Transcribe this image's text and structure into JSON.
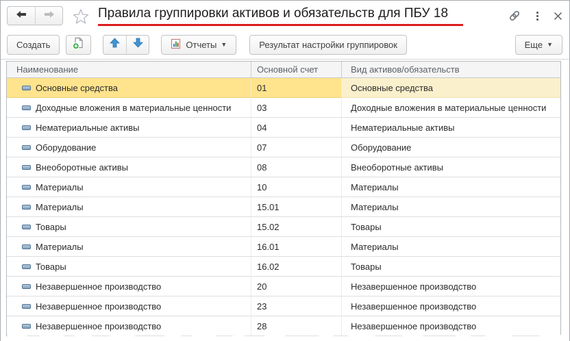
{
  "window": {
    "title": "Правила группировки активов и обязательств для ПБУ 18"
  },
  "caption_icons": {
    "link": "link-icon",
    "menu": "kebab-menu-icon",
    "close": "close-icon",
    "back": "back-arrow-icon",
    "forward": "forward-arrow-icon",
    "favorite": "star-icon"
  },
  "toolbar": {
    "create_label": "Создать",
    "create_group_icon": "create-group-icon",
    "move_up_icon": "arrow-up-icon",
    "move_down_icon": "arrow-down-icon",
    "reports_label": "Отчеты",
    "reports_icon": "report-chart-icon",
    "result_label": "Результат настройки группировок",
    "more_label": "Еще",
    "caret_char": "▼"
  },
  "table": {
    "columns": [
      "Наименование",
      "Основной счет",
      "Вид активов/обязательств"
    ],
    "selected_row_index": 0,
    "rows": [
      {
        "name": "Основные средства",
        "account": "01",
        "kind": "Основные средства"
      },
      {
        "name": "Доходные вложения в материальные ценности",
        "account": "03",
        "kind": "Доходные вложения в материальные ценности"
      },
      {
        "name": "Нематериальные активы",
        "account": "04",
        "kind": "Нематериальные активы"
      },
      {
        "name": "Оборудование",
        "account": "07",
        "kind": "Оборудование"
      },
      {
        "name": "Внеоборотные активы",
        "account": "08",
        "kind": "Внеоборотные активы"
      },
      {
        "name": "Материалы",
        "account": "10",
        "kind": "Материалы"
      },
      {
        "name": "Материалы",
        "account": "15.01",
        "kind": "Материалы"
      },
      {
        "name": "Товары",
        "account": "15.02",
        "kind": "Товары"
      },
      {
        "name": "Материалы",
        "account": "16.01",
        "kind": "Материалы"
      },
      {
        "name": "Товары",
        "account": "16.02",
        "kind": "Товары"
      },
      {
        "name": "Незавершенное производство",
        "account": "20",
        "kind": "Незавершенное производство"
      },
      {
        "name": "Незавершенное производство",
        "account": "23",
        "kind": "Незавершенное производство"
      },
      {
        "name": "Незавершенное производство",
        "account": "28",
        "kind": "Незавершенное производство"
      }
    ]
  },
  "colors": {
    "title_underline": "#dd1c1c",
    "selection": "#ffe38d",
    "selection_light": "#fbf0cc",
    "arrow_blue": "#3e94d4",
    "plus_green": "#3fae49"
  }
}
